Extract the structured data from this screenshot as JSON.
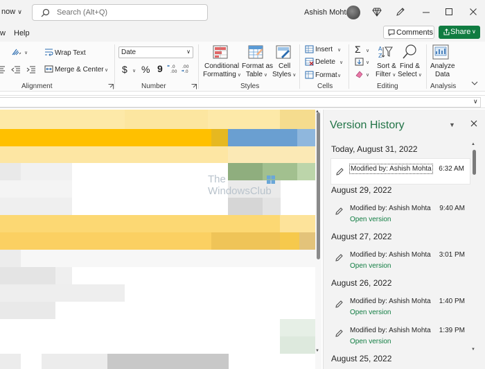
{
  "titlebar": {
    "autosave_label": "now",
    "search_placeholder": "Search (Alt+Q)",
    "username": "Ashish Mohta"
  },
  "menu": {
    "tabs": [
      "w",
      "Help"
    ],
    "comments_label": "Comments",
    "share_label": "Share"
  },
  "ribbon": {
    "alignment": {
      "wrap_text": "Wrap Text",
      "merge_center": "Merge & Center",
      "label": "Alignment"
    },
    "number": {
      "format_value": "Date",
      "currency_symbol": "$",
      "percent_symbol": "%",
      "comma_symbol": "9",
      "label": "Number"
    },
    "styles": {
      "conditional_formatting_l1": "Conditional",
      "conditional_formatting_l2": "Formatting",
      "format_as_table_l1": "Format as",
      "format_as_table_l2": "Table",
      "cell_styles_l1": "Cell",
      "cell_styles_l2": "Styles",
      "label": "Styles"
    },
    "cells": {
      "insert": "Insert",
      "delete": "Delete",
      "format": "Format",
      "label": "Cells"
    },
    "editing": {
      "sum_symbol": "Σ",
      "sort_filter_l1": "Sort &",
      "sort_filter_l2": "Filter",
      "find_select_l1": "Find &",
      "find_select_l2": "Select",
      "label": "Editing"
    },
    "analysis": {
      "analyze_data_l1": "Analyze",
      "analyze_data_l2": "Data",
      "label": "Analysis"
    }
  },
  "watermark": {
    "line1": "The",
    "line2": "WindowsClub"
  },
  "version_history": {
    "title": "Version History",
    "groups": [
      {
        "date": "Today, August 31, 2022",
        "entries": [
          {
            "modified_by": "Modified by: Ashish Mohta",
            "time": "6:32 AM",
            "open_link": "",
            "selected": true
          }
        ]
      },
      {
        "date": "August 29, 2022",
        "entries": [
          {
            "modified_by": "Modified by: Ashish Mohta",
            "time": "9:40 AM",
            "open_link": "Open version",
            "selected": false
          }
        ]
      },
      {
        "date": "August 27, 2022",
        "entries": [
          {
            "modified_by": "Modified by: Ashish Mohta",
            "time": "3:01 PM",
            "open_link": "Open version",
            "selected": false
          }
        ]
      },
      {
        "date": "August 26, 2022",
        "entries": [
          {
            "modified_by": "Modified by: Ashish Mohta",
            "time": "1:40 PM",
            "open_link": "Open version",
            "selected": false
          },
          {
            "modified_by": "Modified by: Ashish Mohta",
            "time": "1:39 PM",
            "open_link": "Open version",
            "selected": false
          }
        ]
      },
      {
        "date": "August 25, 2022",
        "entries": []
      }
    ]
  },
  "colors": {
    "excel_green": "#107c41",
    "pane_title_green": "#217346",
    "sheet_yellow": "#ffc000",
    "sheet_blue": "#5b9bd5",
    "sheet_green": "#70ad47"
  }
}
